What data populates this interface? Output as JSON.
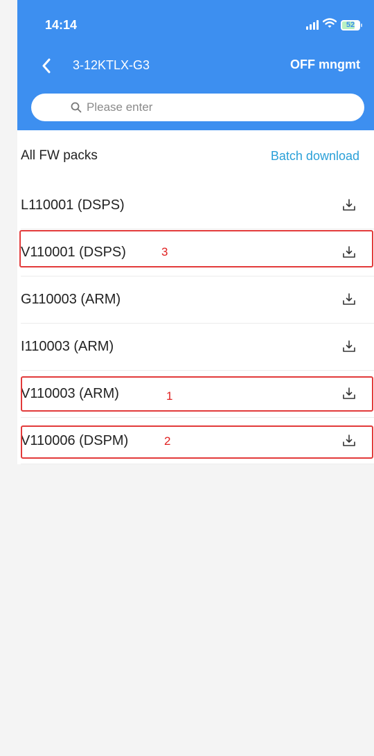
{
  "status_bar": {
    "time": "14:14",
    "battery": "52",
    "icons": [
      "signal-icon",
      "wifi-icon",
      "battery-icon"
    ]
  },
  "nav": {
    "title": "3-12KTLX-G3",
    "action": "OFF mngmt",
    "back_icon": "chevron-left-icon"
  },
  "search": {
    "placeholder": "Please enter",
    "value": ""
  },
  "list": {
    "header_title": "All FW packs",
    "batch_label": "Batch download",
    "items": [
      {
        "label": "L110001 (DSPS)"
      },
      {
        "label": "V110001 (DSPS)"
      },
      {
        "label": "G110003 (ARM)"
      },
      {
        "label": "I110003 (ARM)"
      },
      {
        "label": "V110003 (ARM)"
      },
      {
        "label": "V110006 (DSPM)"
      }
    ]
  },
  "annotations": {
    "markers": [
      "3",
      "1",
      "2"
    ],
    "color": "#e02020"
  },
  "colors": {
    "header": "#3d8ff0",
    "link": "#2aa0d8",
    "background": "#f4f4f4"
  }
}
